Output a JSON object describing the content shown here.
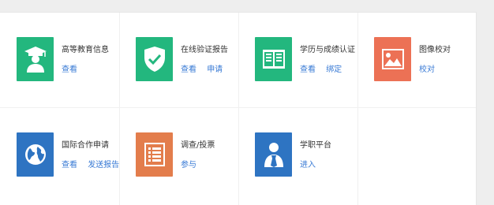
{
  "services": [
    {
      "title": "高等教育信息",
      "icon": "graduate-icon",
      "color": "#23b77e",
      "links": [
        "查看"
      ]
    },
    {
      "title": "在线验证报告",
      "icon": "shield-check-icon",
      "color": "#23b77e",
      "links": [
        "查看",
        "申请"
      ]
    },
    {
      "title": "学历与成绩认证",
      "icon": "book-icon",
      "color": "#23b77e",
      "links": [
        "查看",
        "绑定"
      ]
    },
    {
      "title": "图像校对",
      "icon": "image-icon",
      "color": "#ec7155",
      "links": [
        "校对"
      ]
    },
    {
      "title": "国际合作申请",
      "icon": "globe-icon",
      "color": "#2e74c2",
      "links": [
        "查看",
        "发送报告"
      ]
    },
    {
      "title": "调查/投票",
      "icon": "list-icon",
      "color": "#e37d4c",
      "links": [
        "参与"
      ]
    },
    {
      "title": "学职平台",
      "icon": "person-tie-icon",
      "color": "#2e74c2",
      "links": [
        "进入"
      ]
    }
  ]
}
